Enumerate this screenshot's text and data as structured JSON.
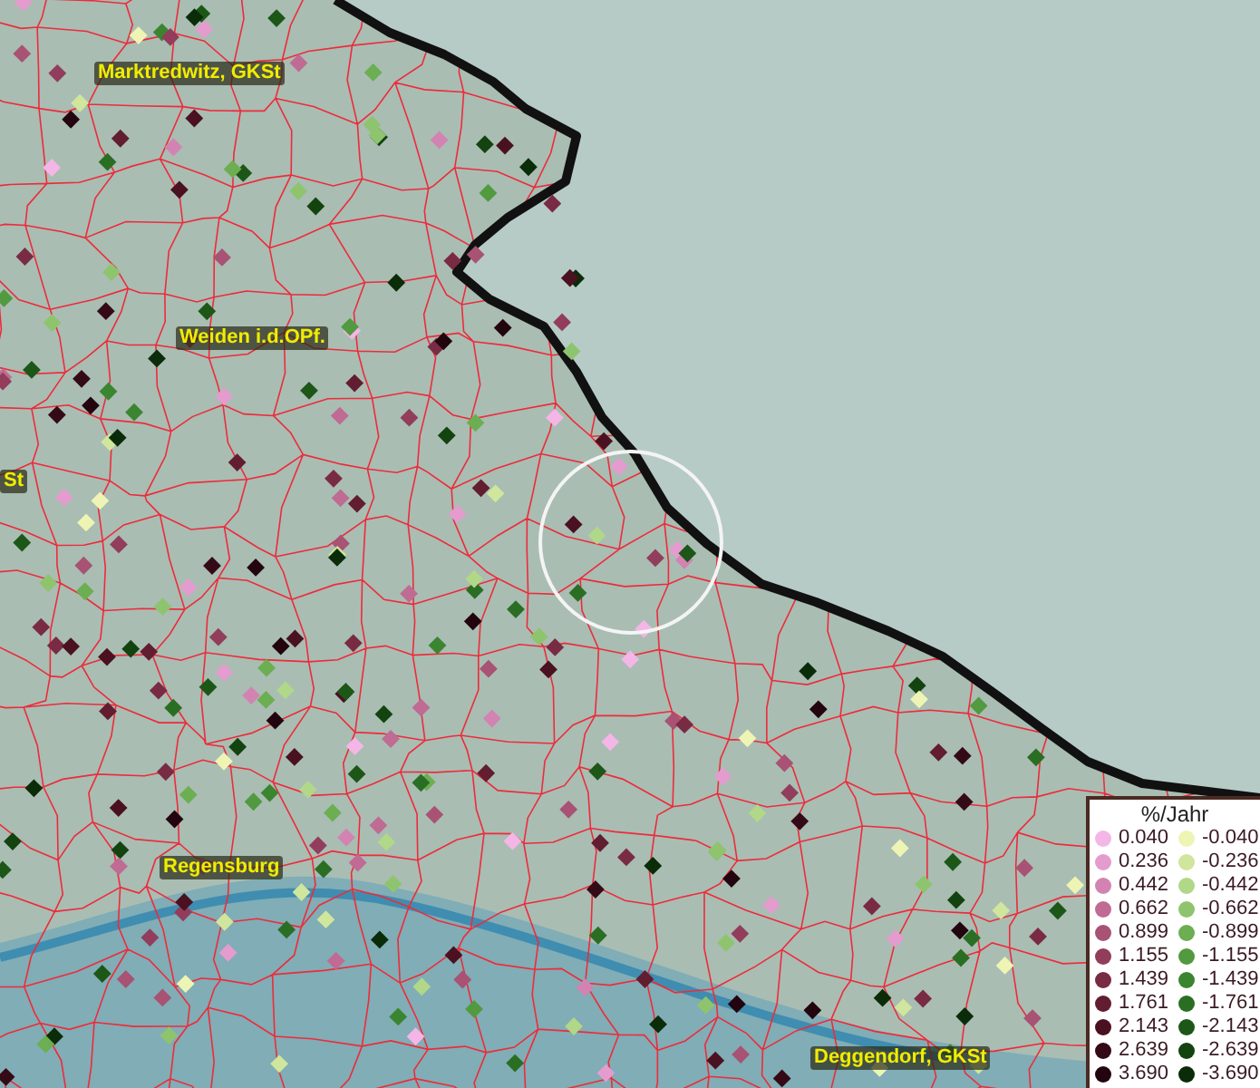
{
  "map": {
    "place_labels": [
      {
        "text": "Marktredwitz, GKSt"
      },
      {
        "text": "Weiden i.d.OPf."
      },
      {
        "text": "St"
      },
      {
        "text": "Regensburg"
      },
      {
        "text": "Deggendorf, GKSt"
      }
    ]
  },
  "legend": {
    "title": "%/Jahr",
    "rows": [
      {
        "positive": {
          "label": "0.040",
          "color": "#f4b6e6"
        },
        "negative": {
          "label": "-0.040",
          "color": "#eef5b4"
        }
      },
      {
        "positive": {
          "label": "0.236",
          "color": "#e49ccf"
        },
        "negative": {
          "label": "-0.236",
          "color": "#cfe69c"
        }
      },
      {
        "positive": {
          "label": "0.442",
          "color": "#d283b2"
        },
        "negative": {
          "label": "-0.442",
          "color": "#b1d788"
        }
      },
      {
        "positive": {
          "label": "0.662",
          "color": "#bf6b93"
        },
        "negative": {
          "label": "-0.662",
          "color": "#8fc46e"
        }
      },
      {
        "positive": {
          "label": "0.899",
          "color": "#a85274"
        },
        "negative": {
          "label": "-0.899",
          "color": "#6cae52"
        }
      },
      {
        "positive": {
          "label": "1.155",
          "color": "#913d5b"
        },
        "negative": {
          "label": "-1.155",
          "color": "#519a3f"
        }
      },
      {
        "positive": {
          "label": "1.439",
          "color": "#7a2b44"
        },
        "negative": {
          "label": "-1.439",
          "color": "#3b8531"
        }
      },
      {
        "positive": {
          "label": "1.761",
          "color": "#621d30"
        },
        "negative": {
          "label": "-1.761",
          "color": "#2a6e24"
        }
      },
      {
        "positive": {
          "label": "2.143",
          "color": "#4a1121"
        },
        "negative": {
          "label": "-2.143",
          "color": "#1d5718"
        }
      },
      {
        "positive": {
          "label": "2.639",
          "color": "#350a17"
        },
        "negative": {
          "label": "-2.639",
          "color": "#13430f"
        }
      },
      {
        "positive": {
          "label": "3.690",
          "color": "#22050e"
        },
        "negative": {
          "label": "-3.690",
          "color": "#0a2c08"
        }
      }
    ]
  }
}
